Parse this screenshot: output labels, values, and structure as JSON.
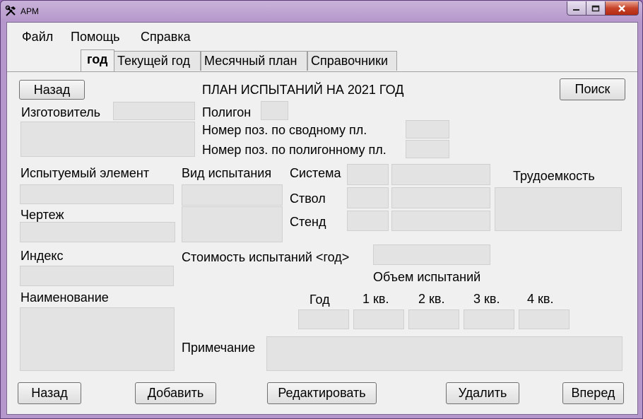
{
  "window": {
    "title": "АРМ"
  },
  "menu": {
    "items": [
      {
        "label": "Файл"
      },
      {
        "label": "Помощь"
      },
      {
        "label": "Справка"
      }
    ]
  },
  "tabs": [
    {
      "label": "год",
      "active": true
    },
    {
      "label": "Текущей год",
      "active": false
    },
    {
      "label": "Месячный план",
      "active": false
    },
    {
      "label": "Справочники",
      "active": false
    }
  ],
  "form": {
    "title": "ПЛАН ИСПЫТАНИЙ НА 2021 ГОД",
    "back_top_label": "Назад",
    "search_label": "Поиск",
    "manufacturer_label": "Изготовитель",
    "manufacturer_value": "",
    "polygon_label": "Полигон",
    "polygon_value": "",
    "summary_pos_label": "Номер поз. по сводному пл.",
    "polygon_pos_label": "Номер поз. по полигонному пл.",
    "test_element_label": "Испытуемый элемент",
    "test_type_label": "Вид испытания",
    "system_label": "Система",
    "barrel_label": "Ствол",
    "stand_label": "Стенд",
    "labor_label": "Трудоемкость",
    "drawing_label": "Чертеж",
    "index_label": "Индекс",
    "cost_label": "Стоимость испытаний <год>",
    "volume_label": "Объем испытаний",
    "name_label": "Наименование",
    "volume_columns": [
      "Год",
      "1 кв.",
      "2 кв.",
      "3 кв.",
      "4 кв."
    ],
    "note_label": "Примечание"
  },
  "actions": {
    "back_label": "Назад",
    "add_label": "Добавить",
    "edit_label": "Редактировать",
    "delete_label": "Удалить",
    "forward_label": "Вперед"
  }
}
